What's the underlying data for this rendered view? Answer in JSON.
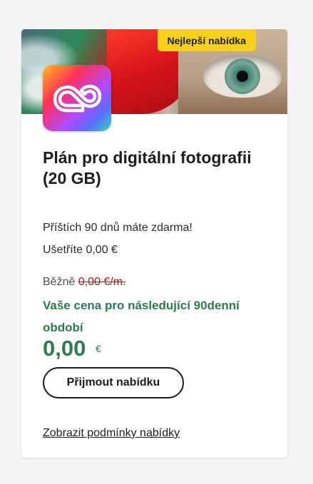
{
  "badge": {
    "label": "Nejlepší nabídka"
  },
  "product": {
    "icon": "creative-cloud-icon",
    "title": "Plán pro digitální fotografii (20 GB)"
  },
  "offer": {
    "free_text": "Příštích 90 dnů máte zdarma!",
    "savings_text": "Ušetříte 0,00 €",
    "regular_label": "Běžně",
    "regular_price": "0,00 €/m.",
    "promo_text": "Vaše cena pro následující 90denní období",
    "price": "0,00",
    "currency": "€"
  },
  "actions": {
    "accept_label": "Přijmout nabídku",
    "terms_label": "Zobrazit podmínky nabídky"
  },
  "colors": {
    "badge": "#f6d11a",
    "promo": "#2d7b4f",
    "strike": "#b4121f"
  }
}
